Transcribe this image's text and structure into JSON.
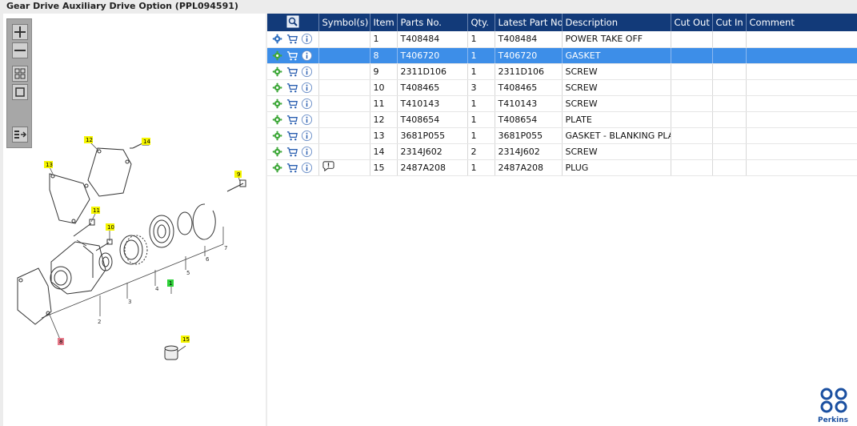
{
  "window": {
    "title": "Gear Drive Auxiliary Drive Option (PPL094591)"
  },
  "toolbar": {
    "zoom_in_icon": "plus-icon",
    "zoom_out_icon": "minus-icon",
    "fit_icon": "grid-icon",
    "actual_size_icon": "square-icon",
    "next_icon": "next-page-icon"
  },
  "table": {
    "headers": [
      "",
      "Symbol(s)",
      "Item",
      "Parts No.",
      "Qty.",
      "Latest Part No.",
      "Description",
      "Cut Out",
      "Cut In",
      "Comment"
    ],
    "rows": [
      {
        "item": "1",
        "part": "T408484",
        "qty": "1",
        "latest": "T408484",
        "desc": "POWER TAKE OFF",
        "symbol": "",
        "selected": false
      },
      {
        "item": "8",
        "part": "T406720",
        "qty": "1",
        "latest": "T406720",
        "desc": "GASKET",
        "symbol": "",
        "selected": true
      },
      {
        "item": "9",
        "part": "2311D106",
        "qty": "1",
        "latest": "2311D106",
        "desc": "SCREW",
        "symbol": "",
        "selected": false
      },
      {
        "item": "10",
        "part": "T408465",
        "qty": "3",
        "latest": "T408465",
        "desc": "SCREW",
        "symbol": "",
        "selected": false
      },
      {
        "item": "11",
        "part": "T410143",
        "qty": "1",
        "latest": "T410143",
        "desc": "SCREW",
        "symbol": "",
        "selected": false
      },
      {
        "item": "12",
        "part": "T408654",
        "qty": "1",
        "latest": "T408654",
        "desc": "PLATE",
        "symbol": "",
        "selected": false
      },
      {
        "item": "13",
        "part": "3681P055",
        "qty": "1",
        "latest": "3681P055",
        "desc": "GASKET - BLANKING PLATE",
        "symbol": "",
        "selected": false
      },
      {
        "item": "14",
        "part": "2314J602",
        "qty": "2",
        "latest": "2314J602",
        "desc": "SCREW",
        "symbol": "",
        "selected": false
      },
      {
        "item": "15",
        "part": "2487A208",
        "qty": "1",
        "latest": "2487A208",
        "desc": "PLUG",
        "symbol": "exclamation-bubble-icon",
        "selected": false
      }
    ]
  },
  "drawing": {
    "callouts": [
      "12",
      "14",
      "13",
      "9",
      "11",
      "10",
      "1",
      "8",
      "15"
    ],
    "leaders": [
      "2",
      "3",
      "4",
      "5",
      "6",
      "7"
    ]
  },
  "brand": {
    "name": "Perkins",
    "color": "#1a4fa0"
  },
  "colors": {
    "header_bg": "#123a79",
    "selected_row": "#3d8ee8",
    "callout_yellow": "#f5f500",
    "callout_green": "#2fd23a",
    "callout_red": "#e87a8a"
  }
}
